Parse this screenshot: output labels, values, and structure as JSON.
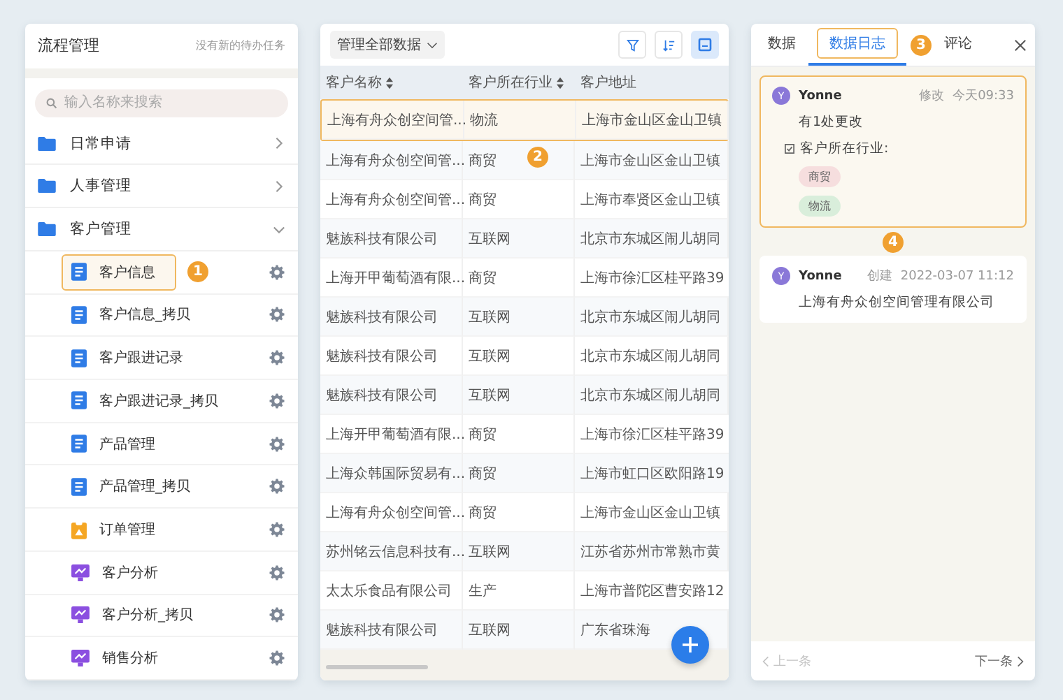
{
  "sidebar": {
    "title": "流程管理",
    "status": "没有新的待办任务",
    "search": {
      "placeholder": "输入名称来搜索"
    },
    "folders": [
      {
        "label": "日常申请",
        "expanded": false
      },
      {
        "label": "人事管理",
        "expanded": false
      },
      {
        "label": "客户管理",
        "expanded": true,
        "children": [
          {
            "label": "客户信息",
            "kind": "form",
            "selected": true,
            "callout": "1"
          },
          {
            "label": "客户信息_拷贝",
            "kind": "form",
            "selected": false
          },
          {
            "label": "客户跟进记录",
            "kind": "form",
            "selected": false
          },
          {
            "label": "客户跟进记录_拷贝",
            "kind": "form",
            "selected": false
          },
          {
            "label": "产品管理",
            "kind": "form",
            "selected": false
          },
          {
            "label": "产品管理_拷贝",
            "kind": "form",
            "selected": false
          },
          {
            "label": "订单管理",
            "kind": "order",
            "selected": false
          },
          {
            "label": "客户分析",
            "kind": "report",
            "selected": false
          },
          {
            "label": "客户分析_拷贝",
            "kind": "report",
            "selected": false
          },
          {
            "label": "销售分析",
            "kind": "report",
            "selected": false
          }
        ]
      }
    ]
  },
  "table": {
    "scope": "管理全部数据",
    "tools": [
      {
        "kind": "filter",
        "selected": false
      },
      {
        "kind": "sort",
        "selected": false
      },
      {
        "kind": "view",
        "selected": true
      }
    ],
    "columns": [
      {
        "label": "客户名称",
        "sortable": true
      },
      {
        "label": "客户所在行业",
        "sortable": true
      },
      {
        "label": "客户地址",
        "sortable": false
      }
    ],
    "rows": [
      {
        "cells": [
          "上海有舟众创空间管...",
          "物流",
          "上海市金山区金山卫镇"
        ],
        "selected": true
      },
      {
        "cells": [
          "上海有舟众创空间管...",
          "商贸",
          "上海市金山区金山卫镇"
        ],
        "selected": false,
        "callout": "2"
      },
      {
        "cells": [
          "上海有舟众创空间管...",
          "商贸",
          "上海市奉贤区金山卫镇"
        ],
        "selected": false
      },
      {
        "cells": [
          "魅族科技有限公司",
          "互联网",
          "北京市东城区闹儿胡同"
        ],
        "selected": false
      },
      {
        "cells": [
          "上海开甲葡萄酒有限...",
          "商贸",
          "上海市徐汇区桂平路39"
        ],
        "selected": false
      },
      {
        "cells": [
          "魅族科技有限公司",
          "互联网",
          "北京市东城区闹儿胡同"
        ],
        "selected": false
      },
      {
        "cells": [
          "魅族科技有限公司",
          "互联网",
          "北京市东城区闹儿胡同"
        ],
        "selected": false
      },
      {
        "cells": [
          "魅族科技有限公司",
          "互联网",
          "北京市东城区闹儿胡同"
        ],
        "selected": false
      },
      {
        "cells": [
          "上海开甲葡萄酒有限...",
          "商贸",
          "上海市徐汇区桂平路39"
        ],
        "selected": false
      },
      {
        "cells": [
          "上海众韩国际贸易有...",
          "商贸",
          "上海市虹口区欧阳路19"
        ],
        "selected": false
      },
      {
        "cells": [
          "上海有舟众创空间管...",
          "商贸",
          "上海市金山区金山卫镇"
        ],
        "selected": false
      },
      {
        "cells": [
          "苏州铭云信息科技有...",
          "互联网",
          "江苏省苏州市常熟市黄"
        ],
        "selected": false
      },
      {
        "cells": [
          "太太乐食品有限公司",
          "生产",
          "上海市普陀区曹安路12"
        ],
        "selected": false
      },
      {
        "cells": [
          "魅族科技有限公司",
          "互联网",
          "广东省珠海"
        ],
        "selected": false
      }
    ]
  },
  "log": {
    "tabs": [
      {
        "label": "数据",
        "selected": false
      },
      {
        "label": "数据日志",
        "selected": true,
        "callout": "3"
      },
      {
        "label": "评论",
        "selected": false
      }
    ],
    "entries": [
      {
        "avatar": "Y",
        "user": "Yonne",
        "action": "修改",
        "time": "今天09:33",
        "selected": true,
        "summary": "有1处更改",
        "field": "客户所在行业:",
        "old_value": "商贸",
        "new_value": "物流"
      },
      {
        "avatar": "Y",
        "user": "Yonne",
        "action": "创建",
        "time": "2022-03-07 11:12",
        "selected": false,
        "callout": "4",
        "detail": "上海有舟众创空间管理有限公司"
      }
    ],
    "prev": {
      "label": "上一条",
      "disabled": true
    },
    "next": {
      "label": "下一条",
      "disabled": false
    }
  }
}
